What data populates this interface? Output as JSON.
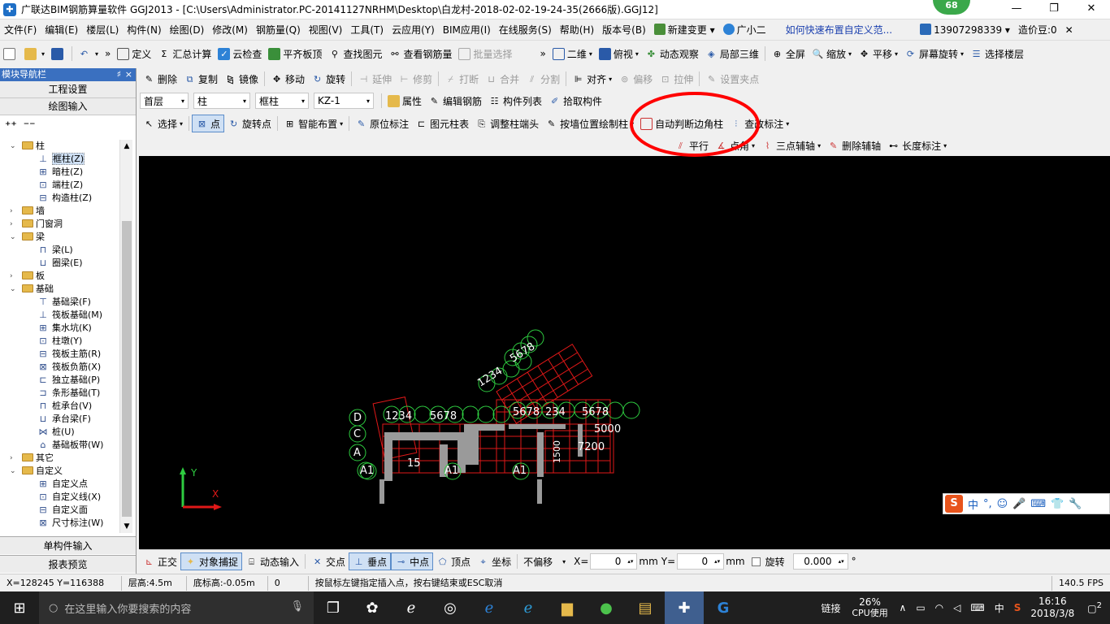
{
  "window": {
    "title": "广联达BIM钢筋算量软件 GGJ2013 - [C:\\Users\\Administrator.PC-20141127NRHM\\Desktop\\白龙村-2018-02-02-19-24-35(2666版).GGJ12]",
    "badge": "68",
    "min": "—",
    "max": "❐",
    "close": "✕"
  },
  "menu": {
    "items": [
      "文件(F)",
      "编辑(E)",
      "楼层(L)",
      "构件(N)",
      "绘图(D)",
      "修改(M)",
      "钢筋量(Q)",
      "视图(V)",
      "工具(T)",
      "云应用(Y)",
      "BIM应用(I)",
      "在线服务(S)",
      "帮助(H)",
      "版本号(B)"
    ],
    "new_change": "新建变更",
    "assistant": "广小二",
    "help_link": "如何快速布置自定义范...",
    "phone": "13907298339",
    "bean": "造价豆:0",
    "close": "✕"
  },
  "toolbar1": {
    "items": [
      "定义",
      "汇总计算",
      "云检查",
      "平齐板顶",
      "查找图元",
      "查看钢筋量",
      "批量选择"
    ],
    "view_items": [
      "二维",
      "俯视",
      "动态观察",
      "局部三维",
      "全屏",
      "缩放",
      "平移",
      "屏幕旋转",
      "选择楼层"
    ]
  },
  "toolbar2": {
    "items": [
      "删除",
      "复制",
      "镜像",
      "移动",
      "旋转",
      "延伸",
      "修剪",
      "打断",
      "合并",
      "分割",
      "对齐",
      "偏移",
      "拉伸",
      "设置夹点"
    ]
  },
  "toolbar3": {
    "floor": "首层",
    "category": "柱",
    "type": "框柱",
    "component": "KZ-1",
    "items": [
      "属性",
      "编辑钢筋",
      "构件列表",
      "拾取构件"
    ]
  },
  "toolbar4": {
    "items": [
      "选择",
      "点",
      "旋转点",
      "智能布置",
      "原位标注",
      "图元柱表",
      "调整柱端头",
      "按墙位置绘制柱",
      "自动判断边角柱",
      "查改标注"
    ]
  },
  "toolbar5": {
    "items": [
      "平行",
      "点角",
      "三点辅轴",
      "删除辅轴",
      "长度标注"
    ]
  },
  "panel": {
    "header": "模块导航栏",
    "pin": "♯",
    "close": "×",
    "btn_project": "工程设置",
    "btn_drawing": "绘图输入",
    "btn_single": "单构件输入",
    "btn_report": "报表预览"
  },
  "tree": [
    {
      "level": 0,
      "label": "柱",
      "open": true
    },
    {
      "level": 1,
      "label": "框柱(Z)",
      "selected": true
    },
    {
      "level": 1,
      "label": "暗柱(Z)"
    },
    {
      "level": 1,
      "label": "端柱(Z)"
    },
    {
      "level": 1,
      "label": "构造柱(Z)"
    },
    {
      "level": 0,
      "label": "墙",
      "open": false
    },
    {
      "level": 0,
      "label": "门窗洞",
      "open": false
    },
    {
      "level": 0,
      "label": "梁",
      "open": true
    },
    {
      "level": 1,
      "label": "梁(L)"
    },
    {
      "level": 1,
      "label": "圈梁(E)"
    },
    {
      "level": 0,
      "label": "板",
      "open": false
    },
    {
      "level": 0,
      "label": "基础",
      "open": true
    },
    {
      "level": 1,
      "label": "基础梁(F)"
    },
    {
      "level": 1,
      "label": "筏板基础(M)"
    },
    {
      "level": 1,
      "label": "集水坑(K)"
    },
    {
      "level": 1,
      "label": "柱墩(Y)"
    },
    {
      "level": 1,
      "label": "筏板主筋(R)"
    },
    {
      "level": 1,
      "label": "筏板负筋(X)"
    },
    {
      "level": 1,
      "label": "独立基础(P)"
    },
    {
      "level": 1,
      "label": "条形基础(T)"
    },
    {
      "level": 1,
      "label": "桩承台(V)"
    },
    {
      "level": 1,
      "label": "承台梁(F)"
    },
    {
      "level": 1,
      "label": "桩(U)"
    },
    {
      "level": 1,
      "label": "基础板带(W)"
    },
    {
      "level": 0,
      "label": "其它",
      "open": false
    },
    {
      "level": 0,
      "label": "自定义",
      "open": true
    },
    {
      "level": 1,
      "label": "自定义点"
    },
    {
      "level": 1,
      "label": "自定义线(X)"
    },
    {
      "level": 1,
      "label": "自定义面"
    },
    {
      "level": 1,
      "label": "尺寸标注(W)"
    }
  ],
  "bottom_toolbar": {
    "items": [
      "正交",
      "对象捕捉",
      "动态输入",
      "交点",
      "垂点",
      "中点",
      "顶点",
      "坐标"
    ],
    "offset": "不偏移",
    "x_label": "X=",
    "x_value": "0",
    "y_label": "Y=",
    "y_value": "0",
    "unit": "mm",
    "rotate": "旋转",
    "rotate_value": "0.000",
    "degree": "°"
  },
  "status": {
    "coords": "X=128245 Y=116388",
    "floor_height": "层高:4.5m",
    "base_height": "底标高:-0.05m",
    "zero": "0",
    "hint": "按鼠标左键指定插入点，按右键结束或ESC取消",
    "fps": "140.5 FPS"
  },
  "taskbar": {
    "search": "在这里输入你要搜索的内容",
    "link": "链接",
    "cpu_pct": "26%",
    "cpu_label": "CPU使用",
    "ime": "中",
    "time": "16:16",
    "date": "2018/3/8",
    "notify": "2"
  },
  "ime_bar": {
    "logo": "S",
    "items": [
      "中",
      "°,",
      "☺",
      "🎤",
      "⌨",
      "👕",
      "🔧"
    ]
  },
  "canvas": {
    "axis_y": "Y",
    "axis_x": "X",
    "labels": [
      "1234",
      "5678",
      "5678",
      "234",
      "5678",
      "1234",
      "5678",
      "D",
      "C",
      "A",
      "A1",
      "A1",
      "A1",
      "7200",
      "5000",
      "15",
      "1500"
    ]
  },
  "colors": {
    "accent": "#3a70c0",
    "grid_red": "#e01818",
    "grid_green": "#2ecc40",
    "annotation": "#ff0000"
  }
}
